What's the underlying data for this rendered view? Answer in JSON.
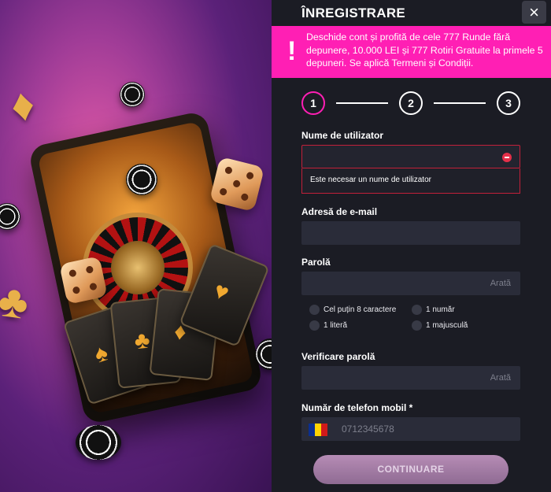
{
  "header": {
    "title": "ÎNREGISTRARE",
    "close_icon": "×"
  },
  "promo_banner": {
    "icon": "!",
    "text": "Deschide cont și profită de cele 777 Runde fără depunere, 10.000 LEI și 777 Rotiri Gratuite la primele 5 depuneri. Se aplică Termeni și Condiții."
  },
  "steps": [
    "1",
    "2",
    "3"
  ],
  "accent_color": "#ff1fb4",
  "form": {
    "username": {
      "label": "Nume de utilizator",
      "value": "",
      "error": "Este necesar un nume de utilizator"
    },
    "email": {
      "label": "Adresă de e-mail",
      "value": ""
    },
    "password": {
      "label": "Parolă",
      "value": "",
      "show_label": "Arată",
      "requirements": [
        "Cel puțin 8 caractere",
        "1 număr",
        "1 literă",
        "1 majusculă"
      ]
    },
    "verify_password": {
      "label": "Verificare parolă",
      "value": "",
      "show_label": "Arată"
    },
    "phone": {
      "label": "Număr de telefon mobil *",
      "placeholder": "0712345678",
      "flag": "Romania flag"
    }
  },
  "continue_button": "CONTINUARE"
}
